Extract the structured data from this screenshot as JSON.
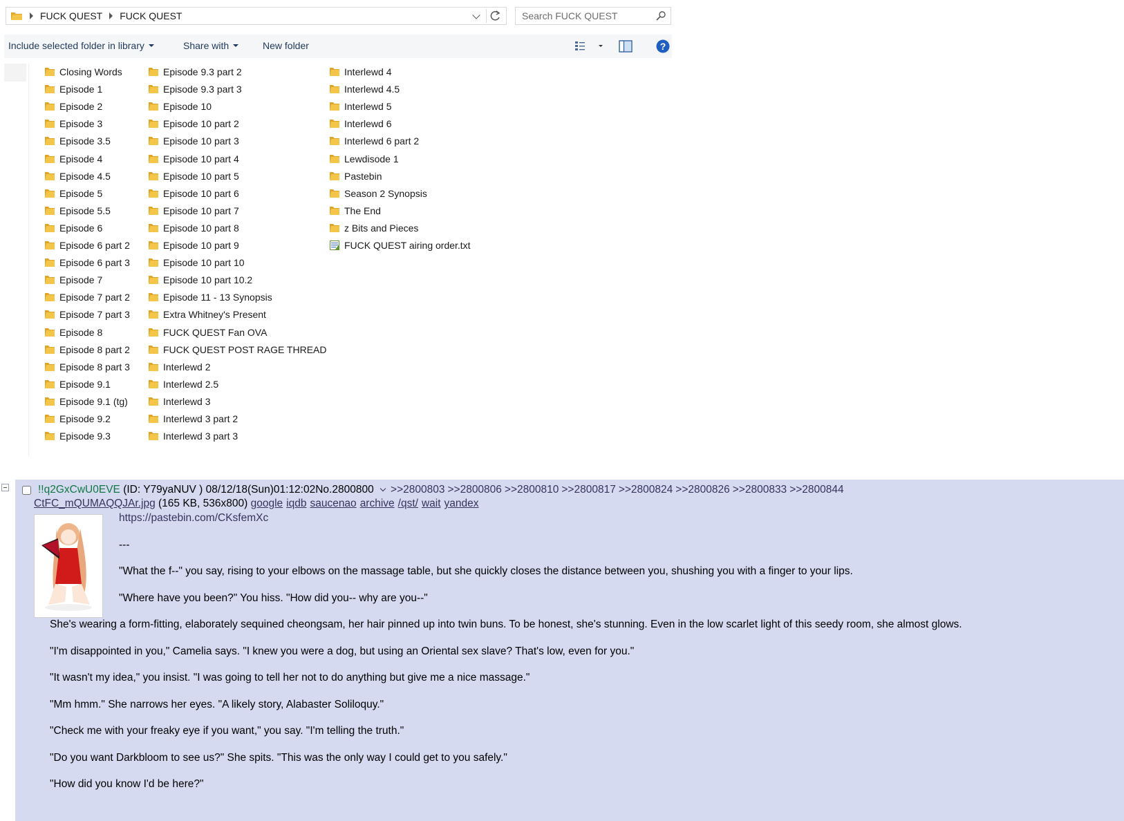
{
  "explorer": {
    "breadcrumbs": [
      "FUCK QUEST",
      "FUCK QUEST"
    ],
    "search_placeholder": "Search FUCK QUEST",
    "toolbar": {
      "include_label": "Include selected folder in library",
      "share_label": "Share with",
      "new_folder_label": "New folder"
    },
    "columns": [
      [
        "Closing Words",
        "Episode 1",
        "Episode 2",
        "Episode 3",
        "Episode 3.5",
        "Episode 4",
        "Episode 4.5",
        "Episode 5",
        "Episode 5.5",
        "Episode 6",
        "Episode 6 part 2",
        "Episode 6 part 3",
        "Episode 7",
        "Episode 7 part 2",
        "Episode 7 part 3",
        "Episode 8",
        "Episode 8 part 2",
        "Episode 8 part 3",
        "Episode 9.1",
        "Episode 9.1 (tg)",
        "Episode 9.2",
        "Episode 9.3"
      ],
      [
        "Episode 9.3 part 2",
        "Episode 9.3 part 3",
        "Episode 10",
        "Episode 10 part 2",
        "Episode 10 part 3",
        "Episode 10 part 4",
        "Episode 10 part 5",
        "Episode 10 part 6",
        "Episode 10 part 7",
        "Episode 10 part 8",
        "Episode 10 part 9",
        "Episode 10 part 10",
        "Episode 10 part 10.2",
        "Episode 11 - 13 Synopsis",
        "Extra Whitney's Present",
        "FUCK QUEST Fan OVA",
        "FUCK QUEST POST RAGE THREAD",
        "Interlewd 2",
        "Interlewd 2.5",
        "Interlewd 3",
        "Interlewd 3 part 2",
        "Interlewd 3 part 3"
      ],
      [
        "Interlewd 4",
        "Interlewd 4.5",
        "Interlewd 5",
        "Interlewd 6",
        "Interlewd 6 part 2",
        "Lewdisode 1",
        "Pastebin",
        "Season 2 Synopsis",
        "The End",
        "z Bits and Pieces",
        "FUCK QUEST airing order.txt"
      ]
    ],
    "text_file_name": "FUCK QUEST airing order.txt",
    "colors": {
      "folder": "#f3c64a",
      "folder_dark": "#e0a526",
      "toolbar_text": "#1e395b",
      "help_blue": "#1f5fbf"
    }
  },
  "post": {
    "tripcode": "!!q2GxCwU0EVE",
    "id_text": "(ID: Y79yaNUV )",
    "datetime": "08/12/18(Sun)01:12:02",
    "post_no": "No.2800800",
    "replies": [
      ">>2800803",
      ">>2800806",
      ">>2800810",
      ">>2800817",
      ">>2800824",
      ">>2800826",
      ">>2800833",
      ">>2800844"
    ],
    "file_name": "CtFC_mQUMAQQJAr.jpg",
    "file_meta": "(165 KB, 536x800)",
    "file_tools": [
      "google",
      "iqdb",
      "saucenao",
      "archive",
      "/qst/",
      "wait",
      "yandex"
    ],
    "paragraphs": [
      "https://pastebin.com/CKsfemXc",
      "---",
      "\"What the f--\" you say, rising to your elbows on the massage table, but she quickly closes the distance between you, shushing you with a finger to your lips.",
      "\"Where have you been?\" You hiss. \"How did you-- why are you--\"",
      "She's wearing a form-fitting, elaborately sequined cheongsam, her hair pinned up into twin buns. To be honest, she's stunning. Even in the low scarlet light of this seedy room, she almost glows.",
      "\"I'm disappointed in you,\" Camelia says. \"I knew you were a dog, but using an Oriental sex slave? That's low, even for you.\"",
      "\"It wasn't my idea,\" you insist. \"I was going to tell her not to do anything but give me a nice massage.\"",
      "\"Mm hmm.\" She narrows her eyes. \"A likely story, Alabaster Soliloquy.\"",
      "\"Check me with your freaky eye if you want,\" you say. \"I'm telling the truth.\"",
      "\"Do you want Darkbloom to see us?\" She spits. \"This was the only way I could get to you safely.\"",
      "\"How did you know I'd be here?\""
    ],
    "colors": {
      "background": "#d6daf0",
      "tripcode": "#117743",
      "link": "#34345c"
    }
  }
}
